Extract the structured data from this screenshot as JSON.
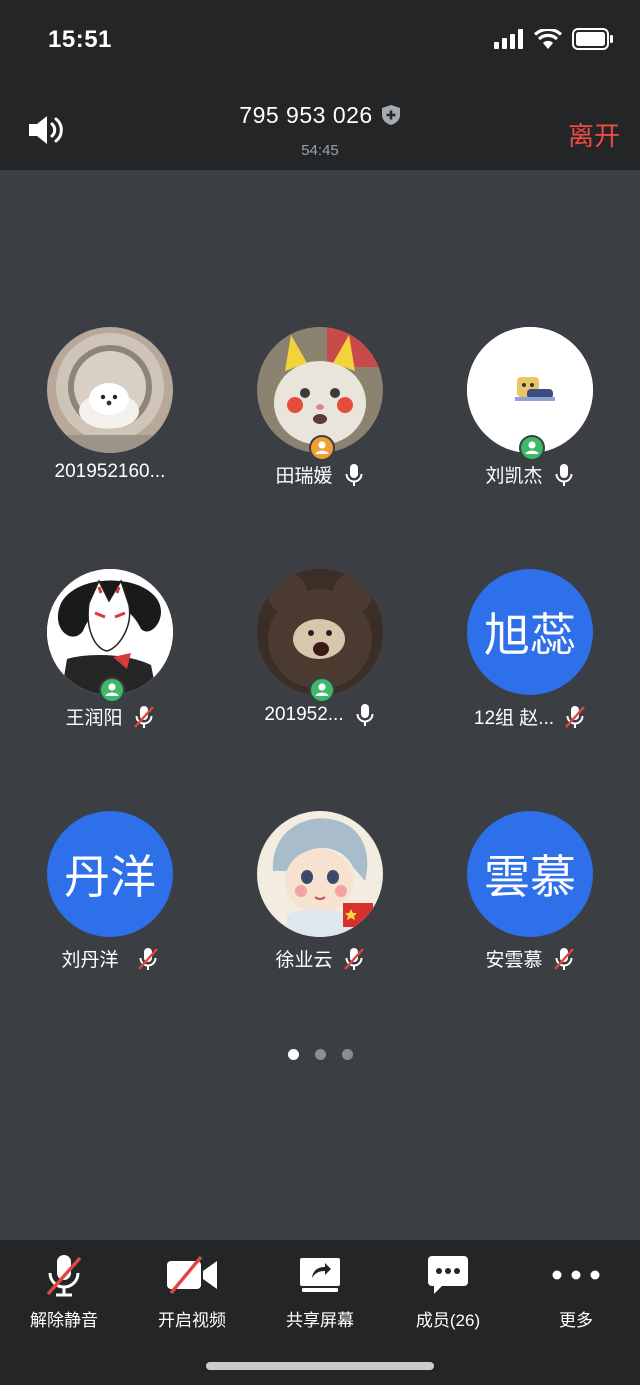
{
  "status_bar": {
    "time": "15:51"
  },
  "header": {
    "meeting_id": "795 953 026",
    "duration": "54:45",
    "leave_label": "离开"
  },
  "participants": [
    {
      "name": "201952160...",
      "avatar": "photo-samoyed-dryer",
      "mic": "none",
      "badge": "none"
    },
    {
      "name": "田瑞媛",
      "avatar": "photo-cat-pikachu",
      "mic": "on",
      "badge": "host-orange"
    },
    {
      "name": "刘凯杰",
      "avatar": "photo-cartoon-sticker",
      "mic": "on",
      "badge": "member-green"
    },
    {
      "name": "王润阳",
      "avatar": "photo-fox-mask-anime",
      "mic": "muted",
      "badge": "member-green"
    },
    {
      "name": "201952...",
      "avatar": "photo-dog-teddy-bear",
      "mic": "on",
      "badge": "member-green"
    },
    {
      "name": "12组 赵...",
      "avatar_text": "旭蕊",
      "mic": "muted",
      "badge": "none"
    },
    {
      "name": "刘丹洋",
      "avatar_text": "丹洋",
      "mic": "muted",
      "badge": "none"
    },
    {
      "name": "徐业云",
      "avatar": "photo-anime-girl-flag",
      "mic": "muted",
      "badge": "none"
    },
    {
      "name": "安雲慕",
      "avatar_text": "雲慕",
      "mic": "muted",
      "badge": "none"
    }
  ],
  "pager": {
    "pages": 3,
    "current": 1
  },
  "toolbar": {
    "unmute_label": "解除静音",
    "video_label": "开启视频",
    "share_label": "共享屏幕",
    "members_label": "成员(26)",
    "more_label": "更多"
  },
  "colors": {
    "background": "#3b3f44",
    "bars": "#232527",
    "leave": "#ef4a44",
    "avatar_blue": "#2e6fea",
    "mute_red": "#e0463f",
    "host_badge": "#f0a030",
    "member_badge": "#3cba6a"
  },
  "icons": {
    "speaker": "speaker-icon",
    "shield": "shield-plus-icon",
    "mic": "mic-icon",
    "mic_muted": "mic-muted-icon",
    "video_off": "video-off-icon",
    "share": "share-screen-icon",
    "members": "chat-bubble-icon",
    "more": "more-dots-icon"
  }
}
